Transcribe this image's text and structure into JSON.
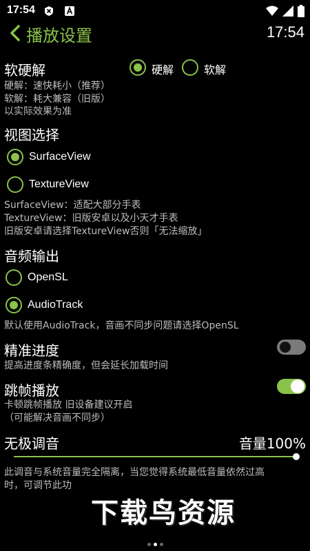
{
  "status_bar": {
    "time": "17:54",
    "icons": [
      "notification-x-icon",
      "a-notification-icon",
      "wifi-icon",
      "signal-icon",
      "battery-icon"
    ]
  },
  "header": {
    "title": "播放设置",
    "clock": "17:54"
  },
  "decode": {
    "title": "软硬解",
    "options": [
      "硬解",
      "软解"
    ],
    "selected": "硬解",
    "desc": [
      "硬解：速快耗小（推荐）",
      "软解：耗大兼容（旧版）",
      "以实际效果为准"
    ]
  },
  "view": {
    "title": "视图选择",
    "options": [
      "SurfaceView",
      "TextureView"
    ],
    "selected": "SurfaceView",
    "desc": [
      "SurfaceView：适配大部分手表",
      "TextureView：旧版安卓以及小天才手表",
      "旧版安卓请选择TextureView否则「无法缩放」"
    ]
  },
  "audio": {
    "title": "音频输出",
    "options": [
      "OpenSL",
      "AudioTrack"
    ],
    "selected": "AudioTrack",
    "desc": "默认使用AudioTrack，音画不同步问题请选择OpenSL"
  },
  "precise_seek": {
    "title": "精准进度",
    "enabled": false,
    "desc": "提高进度条精确度，但会延长加载时间"
  },
  "frame_skip": {
    "title": "跳帧播放",
    "enabled": true,
    "desc": [
      "卡顿跳帧播放 旧设备建议开启",
      "（可能解决音画不同步）"
    ]
  },
  "volume": {
    "title": "无极调音",
    "value_label": "音量100%",
    "level_percent": 100,
    "desc": [
      "此调音与系统音量完全隔离，当您觉得系统最低音量依然过高",
      "时，可调节此功"
    ]
  },
  "watermark": "下载鸟资源",
  "colors": {
    "accent": "#8bc34a",
    "background": "#000000",
    "secondary_text": "#bdbdbd"
  },
  "page_indicator": {
    "count": 3,
    "active": 1
  }
}
